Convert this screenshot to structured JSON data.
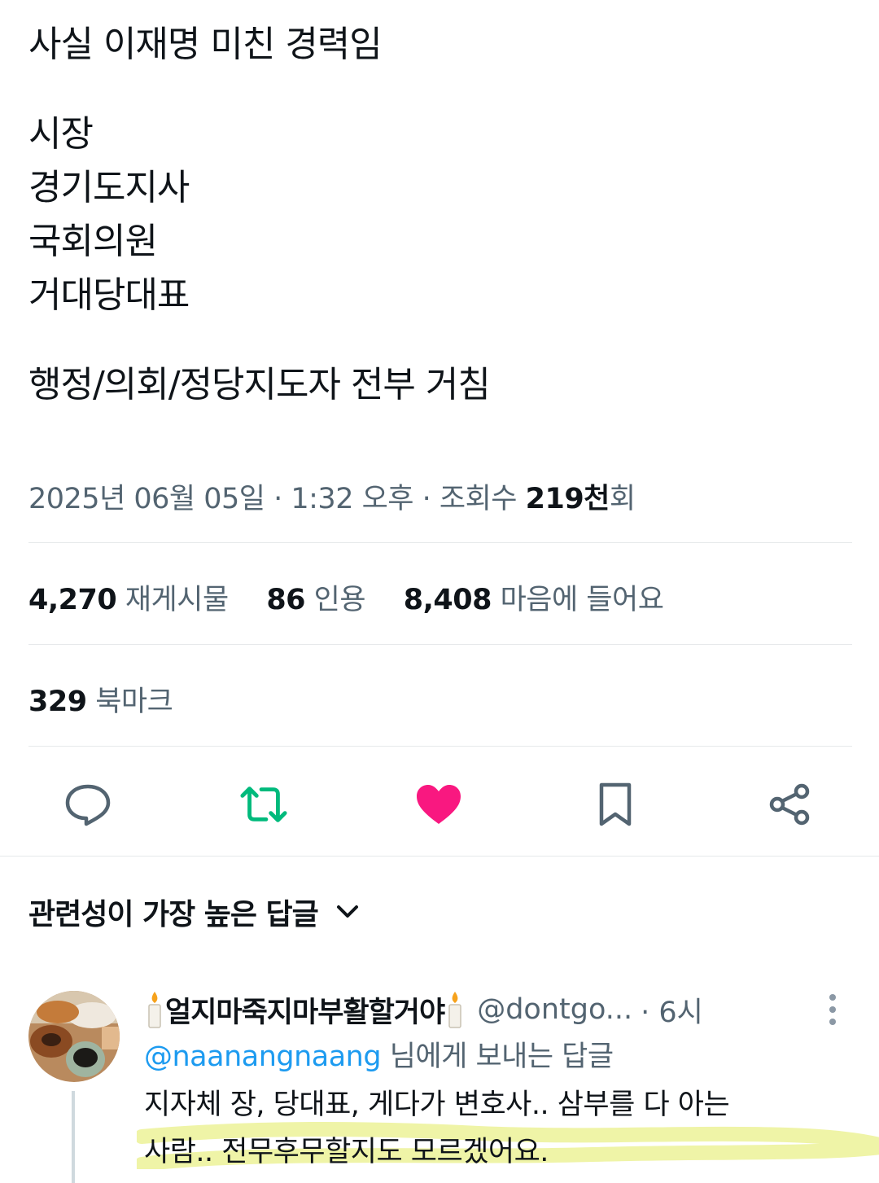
{
  "tweet": {
    "lines": [
      "사실 이재명 미친 경력임",
      "시장",
      "경기도지사",
      "국회의원",
      "거대당대표",
      "행정/의회/정당지도자 전부 거침"
    ],
    "meta_date": "2025년 06월 05일 · 1:32 오후 · 조회수 ",
    "meta_views_num": "219천",
    "meta_views_suffix": "회"
  },
  "stats": {
    "retweets_num": "4,270",
    "retweets_label": "재게시물",
    "quotes_num": "86",
    "quotes_label": "인용",
    "likes_num": "8,408",
    "likes_label": "마음에 들어요",
    "bookmarks_num": "329",
    "bookmarks_label": "북마크"
  },
  "actions": {
    "reply_icon": "comment-icon",
    "retweet_icon": "retweet-icon",
    "retweet_color": "#00ba7c",
    "like_icon": "heart-filled-icon",
    "like_color": "#f91880",
    "bookmark_icon": "bookmark-icon",
    "share_icon": "share-icon"
  },
  "replies_section": {
    "sort_label": "관련성이 가장 높은 답글"
  },
  "reply": {
    "display_name": "얼지마죽지마부활할거야",
    "handle": "@dontgo...",
    "time": "· 6시",
    "reply_to_mention": "@naanangnaang",
    "reply_to_suffix": " 님에게 보내는 답글",
    "text_line1": "지자체 장, 당대표, 게다가 변호사.. 삼부를 다 아는",
    "text_line2": "사람.. 전무후무할지도 모르겠어요."
  }
}
